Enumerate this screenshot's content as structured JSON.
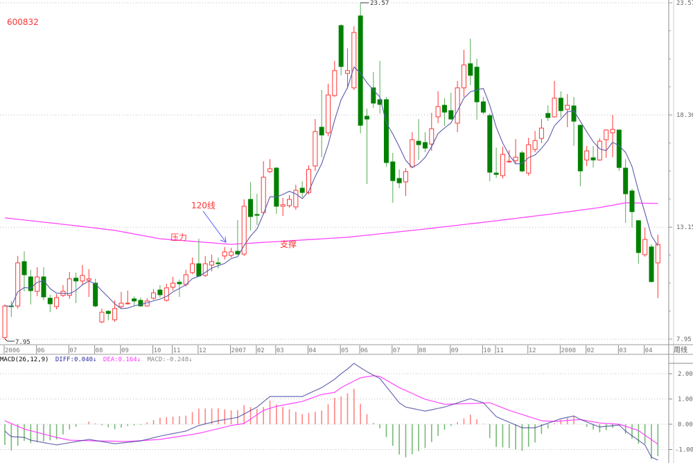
{
  "stock_code": "600832",
  "period_label": "周线",
  "annotations": {
    "ma_label": "120线",
    "resistance": "压力",
    "support": "支撑"
  },
  "macd_header": {
    "title": "MACD(26,12,9)",
    "diff": "DIFF:0.040↓",
    "dea": "DEA:0.164↓",
    "macd": "MACD:-0.248↓"
  },
  "colors": {
    "up": "#ff3333",
    "down": "#008000",
    "ma_short": "#5a5aaa",
    "ma120": "#ff44ff",
    "diff": "#3a3a9a",
    "dea": "#ff44ff",
    "grid": "#bbbbbb"
  },
  "chart_data": {
    "type": "candlestick",
    "title": "600832",
    "period": "weekly",
    "ylim": [
      7.95,
      23.57
    ],
    "y_ticks": [
      "23.57",
      "18.36",
      "13.15",
      "7.95"
    ],
    "y_tick_values": [
      23.57,
      18.36,
      13.15,
      7.95
    ],
    "max_label": "23.57",
    "min_label": "7.95",
    "max_index": 55,
    "min_index": 0,
    "x_ticks": [
      {
        "label": "2006",
        "index": 0
      },
      {
        "label": "06",
        "index": 5
      },
      {
        "label": "07",
        "index": 10
      },
      {
        "label": "08",
        "index": 14
      },
      {
        "label": "09",
        "index": 18
      },
      {
        "label": "10",
        "index": 23
      },
      {
        "label": "11",
        "index": 26
      },
      {
        "label": "12",
        "index": 30
      },
      {
        "label": "2007",
        "index": 35
      },
      {
        "label": "02",
        "index": 39
      },
      {
        "label": "03",
        "index": 42
      },
      {
        "label": "04",
        "index": 47
      },
      {
        "label": "05",
        "index": 52
      },
      {
        "label": "06",
        "index": 55
      },
      {
        "label": "07",
        "index": 60
      },
      {
        "label": "08",
        "index": 64
      },
      {
        "label": "09",
        "index": 69
      },
      {
        "label": "10",
        "index": 74
      },
      {
        "label": "11",
        "index": 76
      },
      {
        "label": "12",
        "index": 81
      },
      {
        "label": "2008",
        "index": 86
      },
      {
        "label": "02",
        "index": 90
      },
      {
        "label": "03",
        "index": 95
      },
      {
        "label": "04",
        "index": 99
      }
    ],
    "ohlc_fields": [
      "open",
      "high",
      "low",
      "close"
    ],
    "candles": [
      [
        8.02,
        9.56,
        7.95,
        9.49
      ],
      [
        9.49,
        9.72,
        8.98,
        9.46
      ],
      [
        9.49,
        11.81,
        9.37,
        11.49
      ],
      [
        11.55,
        12.03,
        10.17,
        10.94
      ],
      [
        10.84,
        11.17,
        9.56,
        10.2
      ],
      [
        10.17,
        11.29,
        9.94,
        10.84
      ],
      [
        10.84,
        11.29,
        9.75,
        9.91
      ],
      [
        9.85,
        10.01,
        9.2,
        9.59
      ],
      [
        9.46,
        10.04,
        9.33,
        9.88
      ],
      [
        9.98,
        10.46,
        9.91,
        10.17
      ],
      [
        9.98,
        11.07,
        9.82,
        10.75
      ],
      [
        10.78,
        11.04,
        9.62,
        10.65
      ],
      [
        10.65,
        11.39,
        10.49,
        10.91
      ],
      [
        10.68,
        11.2,
        9.91,
        10.75
      ],
      [
        10.55,
        10.75,
        9.43,
        9.49
      ],
      [
        8.75,
        9.37,
        8.69,
        9.2
      ],
      [
        9.24,
        9.3,
        8.82,
        9.14
      ],
      [
        8.85,
        9.75,
        8.75,
        9.37
      ],
      [
        9.46,
        10.14,
        9.4,
        9.62
      ],
      [
        9.59,
        10.2,
        9.56,
        9.62
      ],
      [
        9.82,
        9.94,
        9.49,
        9.72
      ],
      [
        9.75,
        9.88,
        9.46,
        9.49
      ],
      [
        9.49,
        9.85,
        9.46,
        9.72
      ],
      [
        9.85,
        10.27,
        9.78,
        10.1
      ],
      [
        10.23,
        10.46,
        9.88,
        10.01
      ],
      [
        9.75,
        10.52,
        9.69,
        10.33
      ],
      [
        10.36,
        10.84,
        10.2,
        10.55
      ],
      [
        10.59,
        10.72,
        9.91,
        10.52
      ],
      [
        10.49,
        11.17,
        10.39,
        10.94
      ],
      [
        11.04,
        11.74,
        10.97,
        11.45
      ],
      [
        11.45,
        12.61,
        10.84,
        10.88
      ],
      [
        10.91,
        11.81,
        10.84,
        11.45
      ],
      [
        11.39,
        11.87,
        11.1,
        11.55
      ],
      [
        11.49,
        11.74,
        11.23,
        11.45
      ],
      [
        11.81,
        12.23,
        11.65,
        12.0
      ],
      [
        11.84,
        12.19,
        11.74,
        12.0
      ],
      [
        12.03,
        13.48,
        11.87,
        11.9
      ],
      [
        11.9,
        14.44,
        11.81,
        14.12
      ],
      [
        14.44,
        15.25,
        12.99,
        13.64
      ],
      [
        13.74,
        14.7,
        13.25,
        13.7
      ],
      [
        13.83,
        16.21,
        13.74,
        15.47
      ],
      [
        15.73,
        16.31,
        15.66,
        15.86
      ],
      [
        15.89,
        15.95,
        13.77,
        14.12
      ],
      [
        14.12,
        14.51,
        13.67,
        14.19
      ],
      [
        14.15,
        14.64,
        14.06,
        14.44
      ],
      [
        14.09,
        15.12,
        13.96,
        14.86
      ],
      [
        14.96,
        15.28,
        14.54,
        14.76
      ],
      [
        14.76,
        16.02,
        14.67,
        15.83
      ],
      [
        15.99,
        18.17,
        15.76,
        17.59
      ],
      [
        17.79,
        19.52,
        16.4,
        17.43
      ],
      [
        17.53,
        19.81,
        17.37,
        19.29
      ],
      [
        19.26,
        20.87,
        19.2,
        20.42
      ],
      [
        22.51,
        22.57,
        20.2,
        20.61
      ],
      [
        20.29,
        21.45,
        19.59,
        20.42
      ],
      [
        19.62,
        22.48,
        19.52,
        22.19
      ],
      [
        22.96,
        23.57,
        17.5,
        17.88
      ],
      [
        18.3,
        18.65,
        15.15,
        18.17
      ],
      [
        19.62,
        20.36,
        18.69,
        18.91
      ],
      [
        19.07,
        20.87,
        18.43,
        18.85
      ],
      [
        19.07,
        19.2,
        15.95,
        16.15
      ],
      [
        16.18,
        16.6,
        14.28,
        15.31
      ],
      [
        15.41,
        15.83,
        14.96,
        15.21
      ],
      [
        15.25,
        15.89,
        14.6,
        15.73
      ],
      [
        15.95,
        17.56,
        15.89,
        17.21
      ],
      [
        17.14,
        18.17,
        16.27,
        16.98
      ],
      [
        17.08,
        17.56,
        16.63,
        16.82
      ],
      [
        17.01,
        18.46,
        16.69,
        17.72
      ],
      [
        18.27,
        19.46,
        17.98,
        18.75
      ],
      [
        18.81,
        19.14,
        17.85,
        18.49
      ],
      [
        18.56,
        19.39,
        18.14,
        18.17
      ],
      [
        17.98,
        19.94,
        17.56,
        19.62
      ],
      [
        19.62,
        21.39,
        19.2,
        20.68
      ],
      [
        20.74,
        21.9,
        19.75,
        20.2
      ],
      [
        20.58,
        20.97,
        18.14,
        18.97
      ],
      [
        18.97,
        19.2,
        18.4,
        18.49
      ],
      [
        18.33,
        18.43,
        15.28,
        15.7
      ],
      [
        15.66,
        16.85,
        15.44,
        15.6
      ],
      [
        15.54,
        16.89,
        15.41,
        16.53
      ],
      [
        16.18,
        16.73,
        16.15,
        16.21
      ],
      [
        16.24,
        17.24,
        16.08,
        16.4
      ],
      [
        16.6,
        16.69,
        15.7,
        15.76
      ],
      [
        15.66,
        17.3,
        15.54,
        16.98
      ],
      [
        16.76,
        17.62,
        16.63,
        17.17
      ],
      [
        17.27,
        18.17,
        17.05,
        17.75
      ],
      [
        18.43,
        18.81,
        18.08,
        18.24
      ],
      [
        18.27,
        19.94,
        18.24,
        19.14
      ],
      [
        19.14,
        19.46,
        18.24,
        18.56
      ],
      [
        18.62,
        19.33,
        17.79,
        18.81
      ],
      [
        18.78,
        19.2,
        16.92,
        18.07
      ],
      [
        17.88,
        17.91,
        15.05,
        15.76
      ],
      [
        16.27,
        16.92,
        15.99,
        16.69
      ],
      [
        16.37,
        16.92,
        15.92,
        16.27
      ],
      [
        16.27,
        17.27,
        16.24,
        17.14
      ],
      [
        17.21,
        17.69,
        16.37,
        17.66
      ],
      [
        17.53,
        18.36,
        16.4,
        17.69
      ],
      [
        17.66,
        17.66,
        15.76,
        15.92
      ],
      [
        15.89,
        16.31,
        13.35,
        14.7
      ],
      [
        14.83,
        14.93,
        13.13,
        13.87
      ],
      [
        13.45,
        13.48,
        11.45,
        11.97
      ],
      [
        11.87,
        13.13,
        11.78,
        12.58
      ],
      [
        12.23,
        12.35,
        10.59,
        10.62
      ],
      [
        11.49,
        12.8,
        9.85,
        12.35
      ]
    ],
    "ma_short_period": 5,
    "ma120_points": [
      [
        0,
        13.58
      ],
      [
        10,
        13.25
      ],
      [
        17,
        13.0
      ],
      [
        24,
        12.61
      ],
      [
        35,
        12.35
      ],
      [
        42,
        12.48
      ],
      [
        53,
        12.68
      ],
      [
        64,
        13.03
      ],
      [
        75,
        13.41
      ],
      [
        84,
        13.74
      ],
      [
        92,
        14.06
      ],
      [
        96,
        14.28
      ],
      [
        101,
        14.25
      ]
    ],
    "macd": {
      "params": [
        26,
        12,
        9
      ],
      "y_ticks": [
        "2.00",
        "1.00",
        "0.00",
        "-1.00"
      ],
      "y_tick_values": [
        2,
        1,
        0,
        -1
      ],
      "diff_points": [
        [
          0,
          -0.27
        ],
        [
          1,
          -0.49
        ],
        [
          3,
          -0.52
        ],
        [
          4,
          -0.63
        ],
        [
          8,
          -0.82
        ],
        [
          13,
          -0.6
        ],
        [
          17,
          -0.77
        ],
        [
          21,
          -0.66
        ],
        [
          24,
          -0.47
        ],
        [
          28,
          -0.27
        ],
        [
          30,
          -0.05
        ],
        [
          33,
          0.14
        ],
        [
          36,
          0.27
        ],
        [
          39,
          0.68
        ],
        [
          41,
          1.1
        ],
        [
          46,
          1.1
        ],
        [
          49,
          1.45
        ],
        [
          51,
          1.78
        ],
        [
          52,
          2.0
        ],
        [
          53,
          2.19
        ],
        [
          54,
          2.41
        ],
        [
          56,
          2.08
        ],
        [
          58,
          1.81
        ],
        [
          61,
          0.85
        ],
        [
          62,
          0.68
        ],
        [
          65,
          0.52
        ],
        [
          68,
          0.68
        ],
        [
          72,
          1.01
        ],
        [
          74,
          0.85
        ],
        [
          76,
          0.3
        ],
        [
          80,
          -0.14
        ],
        [
          82,
          -0.14
        ],
        [
          86,
          0.22
        ],
        [
          88,
          0.33
        ],
        [
          89,
          0.19
        ],
        [
          92,
          -0.11
        ],
        [
          95,
          -0.03
        ],
        [
          96,
          -0.27
        ],
        [
          99,
          -0.82
        ],
        [
          100,
          -1.3
        ],
        [
          101,
          -1.42
        ]
      ],
      "dea_points": [
        [
          0,
          0.14
        ],
        [
          3,
          -0.19
        ],
        [
          8,
          -0.52
        ],
        [
          10,
          -0.63
        ],
        [
          14,
          -0.66
        ],
        [
          19,
          -0.68
        ],
        [
          24,
          -0.6
        ],
        [
          30,
          -0.36
        ],
        [
          35,
          -0.05
        ],
        [
          37,
          0.03
        ],
        [
          40,
          0.55
        ],
        [
          42,
          0.71
        ],
        [
          46,
          0.9
        ],
        [
          49,
          1.18
        ],
        [
          51,
          1.26
        ],
        [
          52,
          1.45
        ],
        [
          55,
          1.84
        ],
        [
          57,
          1.92
        ],
        [
          58,
          1.89
        ],
        [
          61,
          1.45
        ],
        [
          65,
          0.99
        ],
        [
          68,
          0.79
        ],
        [
          72,
          0.82
        ],
        [
          75,
          0.85
        ],
        [
          78,
          0.55
        ],
        [
          83,
          0.14
        ],
        [
          85,
          0.11
        ],
        [
          89,
          0.19
        ],
        [
          92,
          0.05
        ],
        [
          95,
          0.0
        ],
        [
          98,
          -0.25
        ],
        [
          101,
          -0.79
        ]
      ]
    }
  }
}
